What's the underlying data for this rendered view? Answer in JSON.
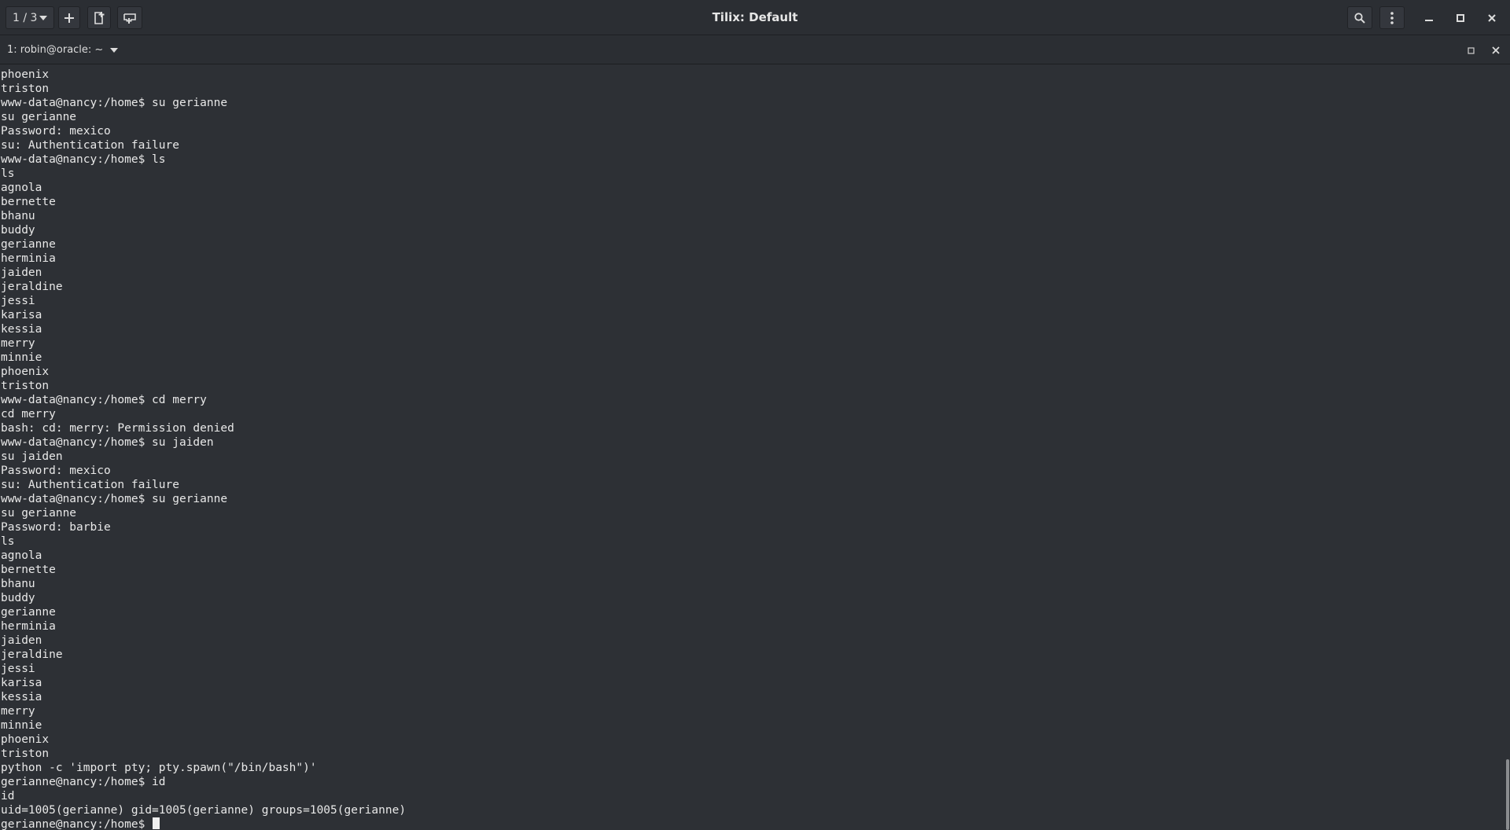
{
  "window": {
    "title": "Tilix: Default"
  },
  "toolbar": {
    "session_label": "1 / 3"
  },
  "terminal": {
    "title": "1: robin@oracle: ~",
    "lines": [
      "phoenix",
      "triston",
      "www-data@nancy:/home$ su gerianne",
      "su gerianne",
      "Password: mexico",
      "su: Authentication failure",
      "www-data@nancy:/home$ ls",
      "ls",
      "agnola",
      "bernette",
      "bhanu",
      "buddy",
      "gerianne",
      "herminia",
      "jaiden",
      "jeraldine",
      "jessi",
      "karisa",
      "kessia",
      "merry",
      "minnie",
      "phoenix",
      "triston",
      "www-data@nancy:/home$ cd merry",
      "cd merry",
      "bash: cd: merry: Permission denied",
      "www-data@nancy:/home$ su jaiden",
      "su jaiden",
      "Password: mexico",
      "su: Authentication failure",
      "www-data@nancy:/home$ su gerianne",
      "su gerianne",
      "Password: barbie",
      "ls",
      "agnola",
      "bernette",
      "bhanu",
      "buddy",
      "gerianne",
      "herminia",
      "jaiden",
      "jeraldine",
      "jessi",
      "karisa",
      "kessia",
      "merry",
      "minnie",
      "phoenix",
      "triston",
      "python -c 'import pty; pty.spawn(\"/bin/bash\")'",
      "gerianne@nancy:/home$ id",
      "id",
      "uid=1005(gerianne) gid=1005(gerianne) groups=1005(gerianne)"
    ],
    "prompt": "gerianne@nancy:/home$ "
  },
  "icons": {
    "add": "plus-icon",
    "split_vertical": "split-vertical-icon",
    "split_horizontal": "split-horizontal-icon",
    "search": "search-icon",
    "menu": "kebab-menu-icon",
    "minimize": "minimize-icon",
    "maximize": "maximize-icon",
    "close": "close-icon"
  }
}
